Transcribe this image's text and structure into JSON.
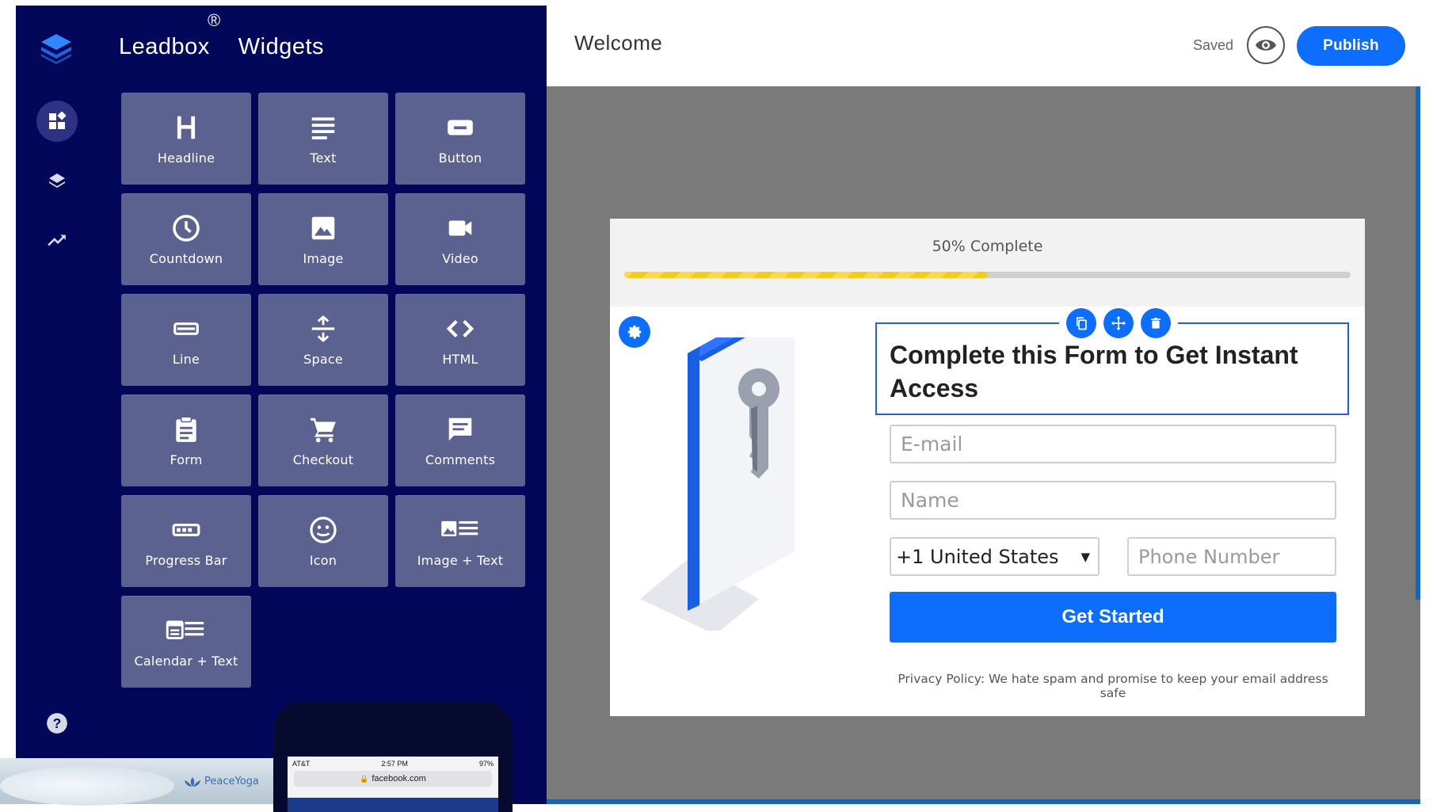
{
  "app": {
    "brand_word1": "Leadbox",
    "brand_word2": "Widgets",
    "brand_reg": "®"
  },
  "rail": {
    "items": [
      {
        "icon": "widgets-icon",
        "active": true
      },
      {
        "icon": "layers-icon",
        "active": false
      },
      {
        "icon": "trending-up-icon",
        "active": false
      }
    ],
    "help_icon": "help-icon"
  },
  "widgets": [
    {
      "label": "Headline",
      "icon": "headline-icon"
    },
    {
      "label": "Text",
      "icon": "text-icon"
    },
    {
      "label": "Button",
      "icon": "button-icon"
    },
    {
      "label": "Countdown",
      "icon": "clock-icon"
    },
    {
      "label": "Image",
      "icon": "image-icon"
    },
    {
      "label": "Video",
      "icon": "video-icon"
    },
    {
      "label": "Line",
      "icon": "line-icon"
    },
    {
      "label": "Space",
      "icon": "space-icon"
    },
    {
      "label": "HTML",
      "icon": "code-icon"
    },
    {
      "label": "Form",
      "icon": "form-icon"
    },
    {
      "label": "Checkout",
      "icon": "cart-icon"
    },
    {
      "label": "Comments",
      "icon": "comment-icon"
    },
    {
      "label": "Progress Bar",
      "icon": "progress-bar-icon"
    },
    {
      "label": "Icon",
      "icon": "smiley-icon"
    },
    {
      "label": "Image + Text",
      "icon": "image-text-icon"
    },
    {
      "label": "Calendar + Text",
      "icon": "calendar-text-icon"
    }
  ],
  "phone_preview": {
    "carrier": "AT&T",
    "time": "2:57 PM",
    "battery": "97%",
    "url": "facebook.com",
    "brand": "PeaceYoga"
  },
  "header": {
    "title": "Welcome",
    "saved": "Saved",
    "publish": "Publish"
  },
  "form": {
    "progress_text": "50% Complete",
    "progress": 0.5,
    "headline": "Complete this Form to Get Instant Access",
    "email_placeholder": "E-mail",
    "name_placeholder": "Name",
    "country": "+1 United States",
    "phone_placeholder": "Phone Number",
    "cta": "Get Started",
    "privacy": "Privacy Policy: We hate spam and promise to keep your email address safe"
  },
  "colors": {
    "sidebar_bg": "#03075a",
    "tile_bg": "#5c628f",
    "accent": "#0d6efd",
    "canvas_bg": "#7a7a7a",
    "progress_fill": "#f7c91b"
  }
}
